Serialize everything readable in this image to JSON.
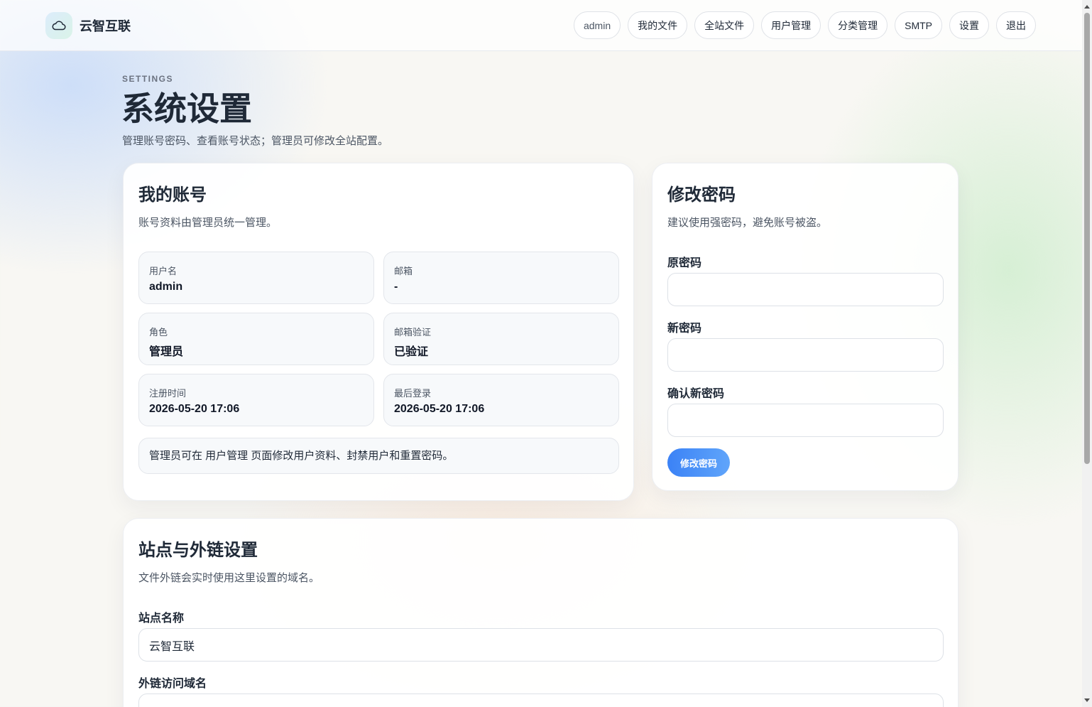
{
  "header": {
    "brand_name": "云智互联",
    "logo_icon": "cloud-icon",
    "nav": {
      "user": "admin",
      "my_files": "我的文件",
      "all_files": "全站文件",
      "users": "用户管理",
      "categories": "分类管理",
      "smtp": "SMTP",
      "settings": "设置",
      "logout": "退出"
    }
  },
  "page": {
    "kicker": "SETTINGS",
    "title": "系统设置",
    "subtitle": "管理账号密码、查看账号状态；管理员可修改全站配置。"
  },
  "account": {
    "title": "我的账号",
    "desc": "账号资料由管理员统一管理。",
    "username_label": "用户名",
    "username": "admin",
    "email_label": "邮箱",
    "email": "-",
    "role_label": "角色",
    "role": "管理员",
    "email_verify_label": "邮箱验证",
    "email_verify": "已验证",
    "registered_label": "注册时间",
    "registered": "2026-05-20 17:06",
    "last_login_label": "最后登录",
    "last_login": "2026-05-20 17:06",
    "note": "管理员可在 用户管理 页面修改用户资料、封禁用户和重置密码。"
  },
  "password": {
    "title": "修改密码",
    "desc": "建议使用强密码，避免账号被盗。",
    "old_label": "原密码",
    "old_value": "",
    "new_label": "新密码",
    "new_value": "",
    "confirm_label": "确认新密码",
    "confirm_value": "",
    "submit": "修改密码"
  },
  "site": {
    "title": "站点与外链设置",
    "desc": "文件外链会实时使用这里设置的域名。",
    "name_label": "站点名称",
    "name_value": "云智互联",
    "domain_label": "外链访问域名"
  },
  "colors": {
    "accent": "#3b82f6",
    "text": "#1f2937",
    "muted": "#4b5563"
  }
}
